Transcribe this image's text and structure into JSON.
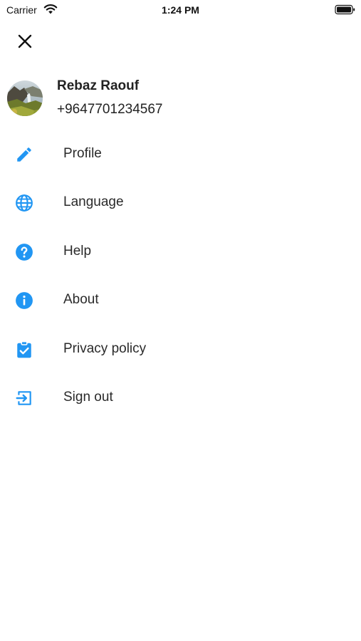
{
  "status_bar": {
    "carrier": "Carrier",
    "time": "1:24 PM"
  },
  "colors": {
    "accent": "#2196F3",
    "text": "#222222",
    "background": "#FFFFFF"
  },
  "user": {
    "name": "Rebaz Raouf",
    "phone": "+9647701234567"
  },
  "menu": {
    "items": [
      {
        "label": "Profile",
        "icon": "pencil-icon"
      },
      {
        "label": "Language",
        "icon": "globe-icon"
      },
      {
        "label": "Help",
        "icon": "help-circle-icon"
      },
      {
        "label": "About",
        "icon": "info-circle-icon"
      },
      {
        "label": "Privacy policy",
        "icon": "clipboard-check-icon"
      },
      {
        "label": "Sign out",
        "icon": "sign-out-icon"
      }
    ]
  }
}
